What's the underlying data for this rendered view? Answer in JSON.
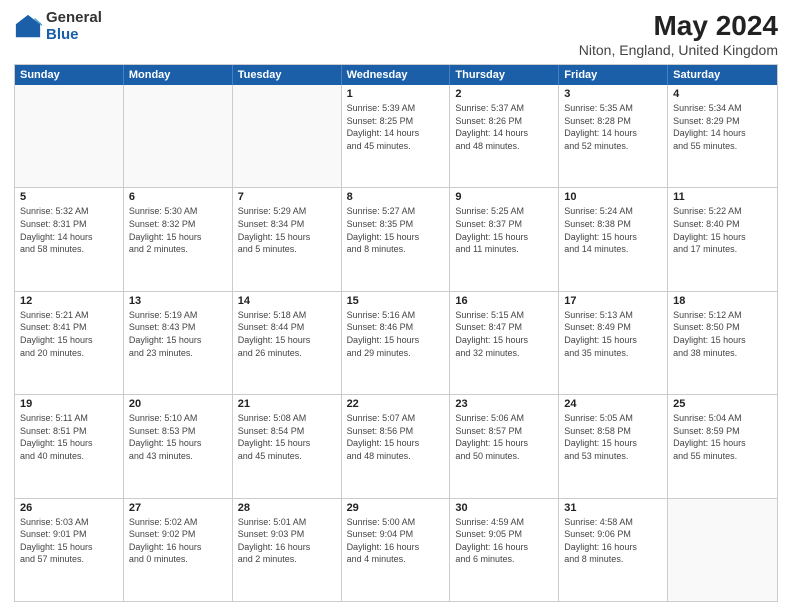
{
  "logo": {
    "general": "General",
    "blue": "Blue"
  },
  "title": "May 2024",
  "subtitle": "Niton, England, United Kingdom",
  "days_of_week": [
    "Sunday",
    "Monday",
    "Tuesday",
    "Wednesday",
    "Thursday",
    "Friday",
    "Saturday"
  ],
  "weeks": [
    [
      {
        "day": "",
        "info": ""
      },
      {
        "day": "",
        "info": ""
      },
      {
        "day": "",
        "info": ""
      },
      {
        "day": "1",
        "info": "Sunrise: 5:39 AM\nSunset: 8:25 PM\nDaylight: 14 hours\nand 45 minutes."
      },
      {
        "day": "2",
        "info": "Sunrise: 5:37 AM\nSunset: 8:26 PM\nDaylight: 14 hours\nand 48 minutes."
      },
      {
        "day": "3",
        "info": "Sunrise: 5:35 AM\nSunset: 8:28 PM\nDaylight: 14 hours\nand 52 minutes."
      },
      {
        "day": "4",
        "info": "Sunrise: 5:34 AM\nSunset: 8:29 PM\nDaylight: 14 hours\nand 55 minutes."
      }
    ],
    [
      {
        "day": "5",
        "info": "Sunrise: 5:32 AM\nSunset: 8:31 PM\nDaylight: 14 hours\nand 58 minutes."
      },
      {
        "day": "6",
        "info": "Sunrise: 5:30 AM\nSunset: 8:32 PM\nDaylight: 15 hours\nand 2 minutes."
      },
      {
        "day": "7",
        "info": "Sunrise: 5:29 AM\nSunset: 8:34 PM\nDaylight: 15 hours\nand 5 minutes."
      },
      {
        "day": "8",
        "info": "Sunrise: 5:27 AM\nSunset: 8:35 PM\nDaylight: 15 hours\nand 8 minutes."
      },
      {
        "day": "9",
        "info": "Sunrise: 5:25 AM\nSunset: 8:37 PM\nDaylight: 15 hours\nand 11 minutes."
      },
      {
        "day": "10",
        "info": "Sunrise: 5:24 AM\nSunset: 8:38 PM\nDaylight: 15 hours\nand 14 minutes."
      },
      {
        "day": "11",
        "info": "Sunrise: 5:22 AM\nSunset: 8:40 PM\nDaylight: 15 hours\nand 17 minutes."
      }
    ],
    [
      {
        "day": "12",
        "info": "Sunrise: 5:21 AM\nSunset: 8:41 PM\nDaylight: 15 hours\nand 20 minutes."
      },
      {
        "day": "13",
        "info": "Sunrise: 5:19 AM\nSunset: 8:43 PM\nDaylight: 15 hours\nand 23 minutes."
      },
      {
        "day": "14",
        "info": "Sunrise: 5:18 AM\nSunset: 8:44 PM\nDaylight: 15 hours\nand 26 minutes."
      },
      {
        "day": "15",
        "info": "Sunrise: 5:16 AM\nSunset: 8:46 PM\nDaylight: 15 hours\nand 29 minutes."
      },
      {
        "day": "16",
        "info": "Sunrise: 5:15 AM\nSunset: 8:47 PM\nDaylight: 15 hours\nand 32 minutes."
      },
      {
        "day": "17",
        "info": "Sunrise: 5:13 AM\nSunset: 8:49 PM\nDaylight: 15 hours\nand 35 minutes."
      },
      {
        "day": "18",
        "info": "Sunrise: 5:12 AM\nSunset: 8:50 PM\nDaylight: 15 hours\nand 38 minutes."
      }
    ],
    [
      {
        "day": "19",
        "info": "Sunrise: 5:11 AM\nSunset: 8:51 PM\nDaylight: 15 hours\nand 40 minutes."
      },
      {
        "day": "20",
        "info": "Sunrise: 5:10 AM\nSunset: 8:53 PM\nDaylight: 15 hours\nand 43 minutes."
      },
      {
        "day": "21",
        "info": "Sunrise: 5:08 AM\nSunset: 8:54 PM\nDaylight: 15 hours\nand 45 minutes."
      },
      {
        "day": "22",
        "info": "Sunrise: 5:07 AM\nSunset: 8:56 PM\nDaylight: 15 hours\nand 48 minutes."
      },
      {
        "day": "23",
        "info": "Sunrise: 5:06 AM\nSunset: 8:57 PM\nDaylight: 15 hours\nand 50 minutes."
      },
      {
        "day": "24",
        "info": "Sunrise: 5:05 AM\nSunset: 8:58 PM\nDaylight: 15 hours\nand 53 minutes."
      },
      {
        "day": "25",
        "info": "Sunrise: 5:04 AM\nSunset: 8:59 PM\nDaylight: 15 hours\nand 55 minutes."
      }
    ],
    [
      {
        "day": "26",
        "info": "Sunrise: 5:03 AM\nSunset: 9:01 PM\nDaylight: 15 hours\nand 57 minutes."
      },
      {
        "day": "27",
        "info": "Sunrise: 5:02 AM\nSunset: 9:02 PM\nDaylight: 16 hours\nand 0 minutes."
      },
      {
        "day": "28",
        "info": "Sunrise: 5:01 AM\nSunset: 9:03 PM\nDaylight: 16 hours\nand 2 minutes."
      },
      {
        "day": "29",
        "info": "Sunrise: 5:00 AM\nSunset: 9:04 PM\nDaylight: 16 hours\nand 4 minutes."
      },
      {
        "day": "30",
        "info": "Sunrise: 4:59 AM\nSunset: 9:05 PM\nDaylight: 16 hours\nand 6 minutes."
      },
      {
        "day": "31",
        "info": "Sunrise: 4:58 AM\nSunset: 9:06 PM\nDaylight: 16 hours\nand 8 minutes."
      },
      {
        "day": "",
        "info": ""
      }
    ]
  ]
}
